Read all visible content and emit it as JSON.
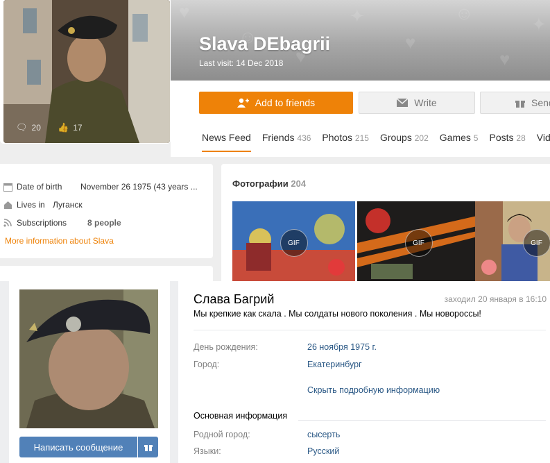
{
  "ok_profile": {
    "name": "Slava DEbagrii",
    "last_visit": "Last visit: 14 Dec 2018",
    "avatar_comments": "20",
    "avatar_likes": "17",
    "buttons": {
      "add_friends": "Add to friends",
      "write": "Write",
      "send": "Send"
    },
    "tabs": [
      {
        "label": "News Feed",
        "count": ""
      },
      {
        "label": "Friends",
        "count": "436"
      },
      {
        "label": "Photos",
        "count": "215"
      },
      {
        "label": "Groups",
        "count": "202"
      },
      {
        "label": "Games",
        "count": "5"
      },
      {
        "label": "Posts",
        "count": "28"
      },
      {
        "label": "Vid",
        "count": ""
      }
    ],
    "info": {
      "dob_label": "Date of birth",
      "dob_value": "November 26 1975 (43 years ...",
      "lives_label": "Lives in",
      "lives_value": "Луганск",
      "subs_label": "Subscriptions",
      "subs_value": "8 people",
      "more_link": "More information about Slava"
    },
    "photos": {
      "title": "Фотографии",
      "count": "204",
      "thumb_labels": [
        "GIF",
        "GIF",
        "GIF"
      ]
    },
    "accent_color": "#ee8208"
  },
  "vk_profile": {
    "name": "Слава Багрий",
    "last_seen": "заходил 20 января в 16:10",
    "status": "Мы крепкие как скала . Мы солдаты нового поколения . Мы новороссы!",
    "birthday_label": "День рождения:",
    "birthday_value": "26 ноября 1975 г.",
    "city_label": "Город:",
    "city_value": "Екатеринбург",
    "hide_link": "Скрыть подробную информацию",
    "section_title": "Основная информация",
    "hometown_label": "Родной город:",
    "hometown_value": "сысерть",
    "languages_label": "Языки:",
    "languages_value": "Русский",
    "message_button": "Написать сообщение",
    "accent_color": "#5181b8"
  }
}
